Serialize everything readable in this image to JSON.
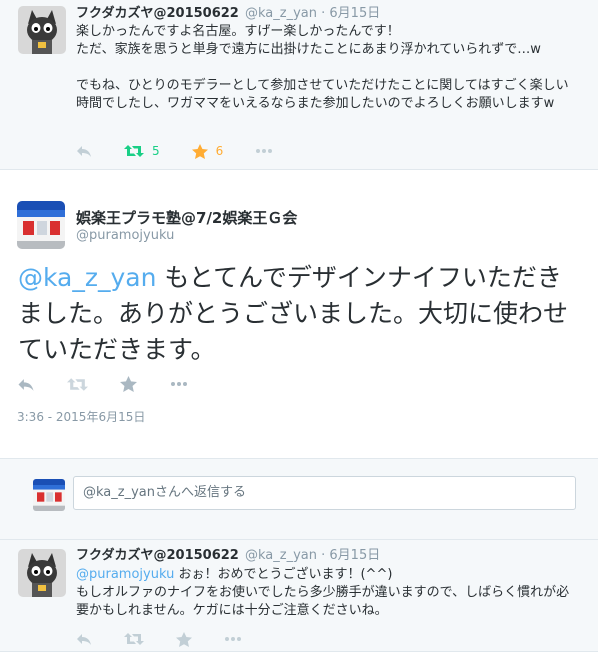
{
  "tweet1": {
    "name": "フクダカズヤ@20150622",
    "handle": "@ka_z_yan",
    "sep": "·",
    "date": "6月15日",
    "text": "楽しかったんですよ名古屋。すげー楽しかったんです！\nただ、家族を思うと単身で遠方に出掛けたことにあまり浮かれていられずで…w\n\nでもね、ひとりのモデラーとして参加させていただけたことに関してはすごく楽しい時間でしたし、ワガママをいえるならまた参加したいのでよろしくお願いしますw",
    "retweet_count": "5",
    "favorite_count": "6"
  },
  "main_tweet": {
    "name": "娯楽王プラモ塾@7/2娯楽王Ｇ会",
    "handle": "@puramojyuku",
    "mention": "@ka_z_yan",
    "text": " もとてんでデザインナイフいただきました。ありがとうございました。大切に使わせていただきます。",
    "timestamp": "3:36 - 2015年6月15日"
  },
  "reply": {
    "placeholder": "@ka_z_yanさんへ返信する"
  },
  "tweet2": {
    "name": "フクダカズヤ@20150622",
    "handle": "@ka_z_yan",
    "sep": "·",
    "date": "6月15日",
    "mention": "@puramojyuku",
    "text": " おぉ！おめでとうございます！(^^)\nもしオルファのナイフをお使いでしたら多少勝手が違いますので、しばらく慣れが必要かもしれません。ケガには十分ご注意くださいね。"
  },
  "icons": [
    "reply-icon",
    "retweet-icon",
    "favorite-icon",
    "more-icon"
  ],
  "colors": {
    "link": "#55acee",
    "retweet": "#19cf86",
    "favorite": "#ffac33",
    "muted": "#8899a6",
    "text": "#292f33",
    "background": "#f5f8fa"
  }
}
